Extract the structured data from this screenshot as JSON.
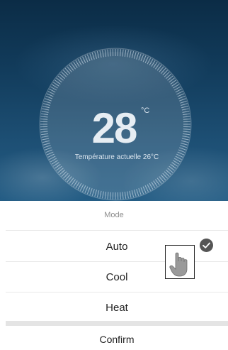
{
  "thermostat": {
    "set_temperature": "28",
    "unit": "°C",
    "current_label": "Température actuelle 26°C"
  },
  "mode_sheet": {
    "title": "Mode",
    "options": [
      {
        "label": "Auto",
        "selected": true
      },
      {
        "label": "Cool",
        "selected": false
      },
      {
        "label": "Heat",
        "selected": false
      }
    ],
    "confirm_label": "Confirm"
  },
  "icons": {
    "selected_check": "check-circle-icon",
    "pointer": "hand-pointer-icon"
  },
  "colors": {
    "background_top": "#0b2c46",
    "background_bottom": "#245d85",
    "check_fill": "#555555",
    "sheet_background": "#ffffff"
  }
}
